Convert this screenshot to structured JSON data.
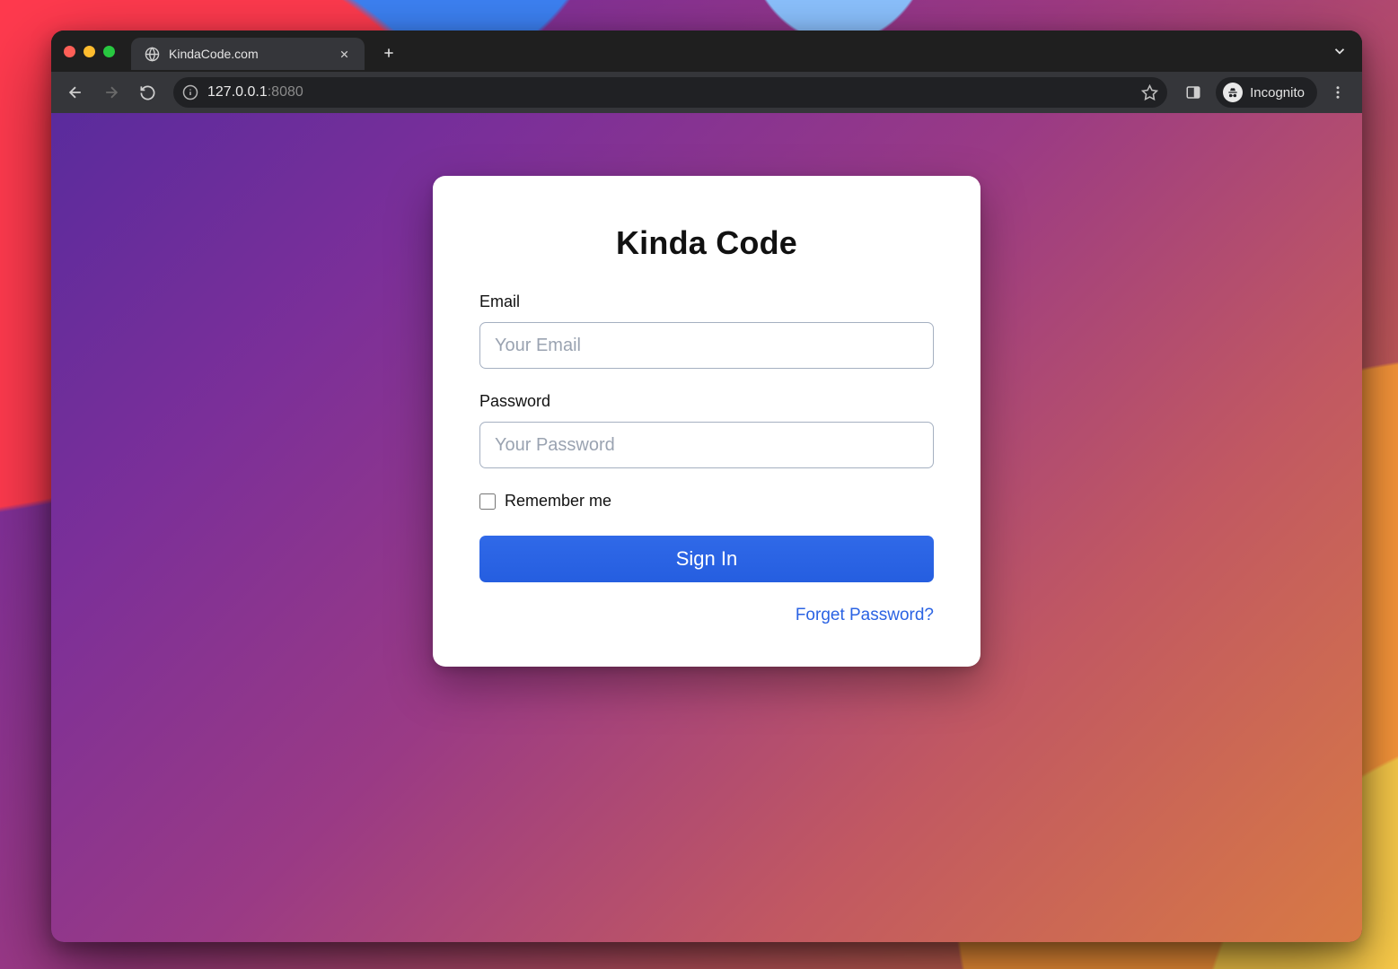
{
  "browser": {
    "tab": {
      "title": "KindaCode.com"
    },
    "address": {
      "main": "127.0.0.1",
      "port": ":8080"
    },
    "incognito_label": "Incognito"
  },
  "page": {
    "title": "Kinda Code",
    "form": {
      "email": {
        "label": "Email",
        "placeholder": "Your Email",
        "value": ""
      },
      "password": {
        "label": "Password",
        "placeholder": "Your Password",
        "value": ""
      },
      "remember_label": "Remember me",
      "remember_checked": false,
      "submit_label": "Sign In",
      "forgot_label": "Forget Password?"
    },
    "colors": {
      "primary": "#2b63e3",
      "card_bg": "#ffffff",
      "input_border": "#a5b0c1"
    }
  }
}
